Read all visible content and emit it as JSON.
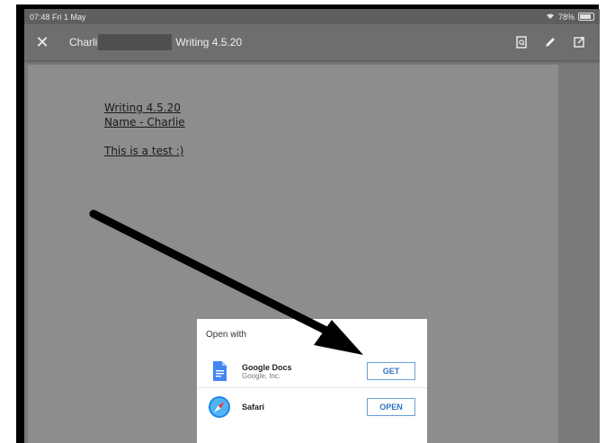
{
  "status_bar": {
    "time": "07:48",
    "date": "Fri 1 May",
    "battery": "78%"
  },
  "toolbar": {
    "title_prefix": "Charli",
    "title_suffix": "Writing 4.5.20"
  },
  "document": {
    "line1": "Writing 4.5.20",
    "line2": "Name - Charlie",
    "line3": "This is a test :)"
  },
  "open_with": {
    "title": "Open with",
    "apps": [
      {
        "name": "Google Docs",
        "publisher": "Google, Inc.",
        "action": "GET"
      },
      {
        "name": "Safari",
        "publisher": "",
        "action": "OPEN"
      }
    ]
  },
  "colors": {
    "accent": "#2f74c0",
    "docs_blue": "#4285f4",
    "annotation_arrow": "#000000"
  }
}
